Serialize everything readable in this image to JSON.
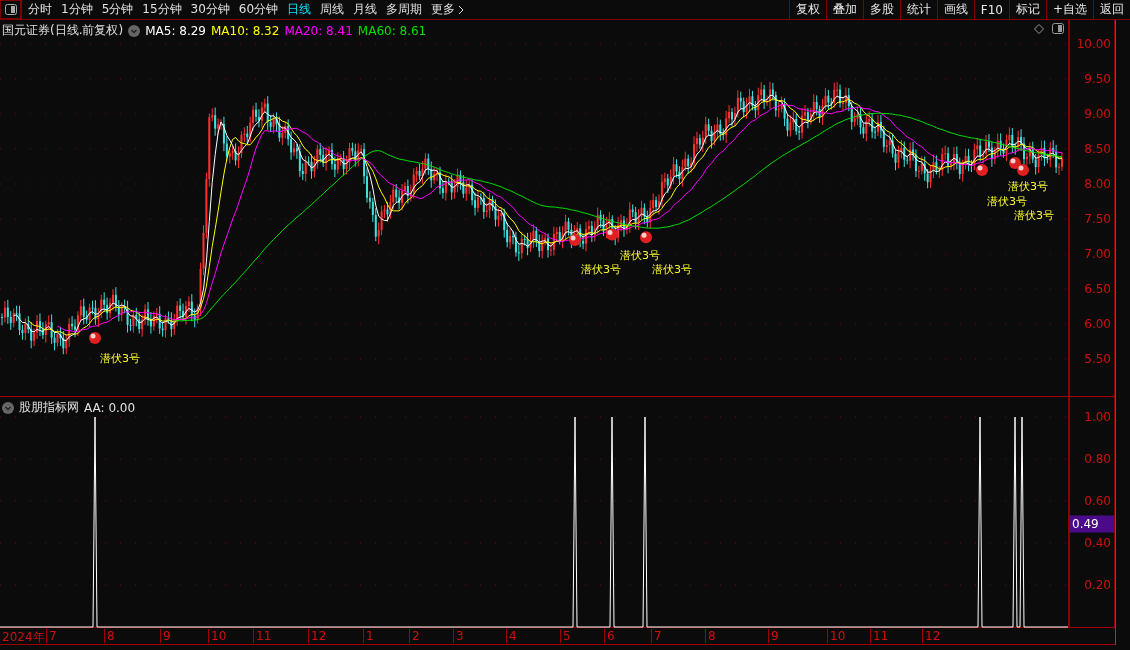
{
  "toolbar": {
    "periods": [
      {
        "label": "分时",
        "selected": false
      },
      {
        "label": "1分钟",
        "selected": false
      },
      {
        "label": "5分钟",
        "selected": false
      },
      {
        "label": "15分钟",
        "selected": false
      },
      {
        "label": "30分钟",
        "selected": false
      },
      {
        "label": "60分钟",
        "selected": false
      },
      {
        "label": "日线",
        "selected": true
      },
      {
        "label": "周线",
        "selected": false
      },
      {
        "label": "月线",
        "selected": false
      },
      {
        "label": "多周期",
        "selected": false
      },
      {
        "label": "更多",
        "selected": false
      }
    ],
    "actions": [
      "复权",
      "叠加",
      "多股",
      "统计",
      "画线",
      "F10",
      "标记",
      "+自选",
      "返回"
    ]
  },
  "price_panel": {
    "title": "国元证券(日线.前复权)",
    "ma": [
      {
        "label": "MA5: 8.29",
        "color": "#ffffff"
      },
      {
        "label": "MA10: 8.32",
        "color": "#ffff00"
      },
      {
        "label": "MA20: 8.41",
        "color": "#ff00ff"
      },
      {
        "label": "MA60: 8.61",
        "color": "#00e000"
      }
    ],
    "axis_labels": [
      "10.00",
      "9.50",
      "9.00",
      "8.50",
      "8.00",
      "7.50",
      "7.00",
      "6.50",
      "6.00",
      "5.50"
    ],
    "signals": [
      "潜伏3号",
      "潜伏3号",
      "潜伏3号",
      "潜伏3号",
      "潜伏3号",
      "潜伏3号",
      "潜伏3号"
    ]
  },
  "indicator_panel": {
    "title": "股朋指标网",
    "reading": "AA: 0.00",
    "axis_labels": [
      "1.00",
      "0.80",
      "0.60",
      "0.40",
      "0.20"
    ],
    "cursor_value": "0.49"
  },
  "time_axis": [
    "2024年",
    "7",
    "8",
    "9",
    "10",
    "11",
    "12",
    "1",
    "2",
    "3",
    "4",
    "5",
    "6",
    "7",
    "8",
    "9",
    "10",
    "11",
    "12"
  ]
}
